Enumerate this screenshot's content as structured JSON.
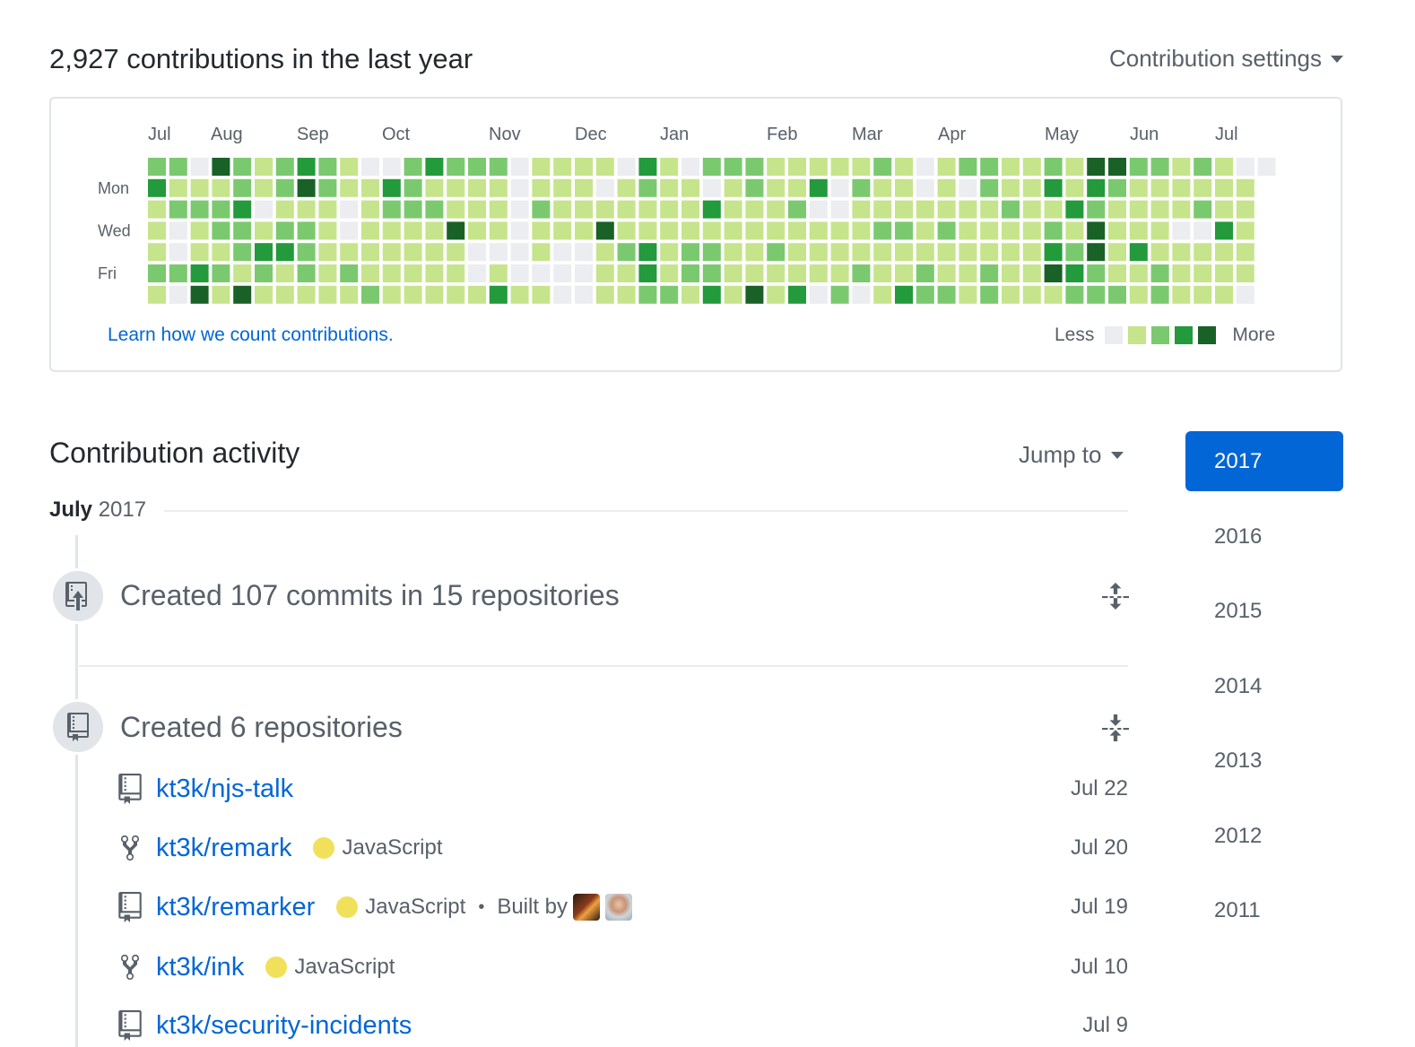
{
  "header": {
    "contributions_title": "2,927 contributions in the last year",
    "settings_label": "Contribution settings",
    "settings_caret_icon": "triangle-down"
  },
  "calendar": {
    "months": [
      "Jul",
      "Aug",
      "Sep",
      "Oct",
      "Nov",
      "Dec",
      "Jan",
      "Feb",
      "Mar",
      "Apr",
      "May",
      "Jun",
      "Jul"
    ],
    "day_labels": [
      "Mon",
      "Wed",
      "Fri"
    ],
    "learn_link": "Learn how we count contributions.",
    "legend_less": "Less",
    "legend_more": "More",
    "colors": [
      "#ebedf0",
      "#c6e48b",
      "#7bc96f",
      "#239a3b",
      "#196127"
    ],
    "weeks": [
      [
        2,
        3,
        1,
        1,
        1,
        2,
        1
      ],
      [
        2,
        1,
        2,
        0,
        0,
        2,
        0
      ],
      [
        0,
        1,
        2,
        1,
        1,
        3,
        4
      ],
      [
        4,
        1,
        2,
        2,
        1,
        2,
        1
      ],
      [
        2,
        2,
        3,
        2,
        2,
        1,
        4
      ],
      [
        1,
        1,
        0,
        1,
        3,
        2,
        1
      ],
      [
        2,
        2,
        1,
        2,
        3,
        1,
        1
      ],
      [
        3,
        4,
        1,
        2,
        2,
        2,
        1
      ],
      [
        2,
        2,
        1,
        1,
        1,
        1,
        1
      ],
      [
        1,
        1,
        0,
        0,
        1,
        2,
        1
      ],
      [
        0,
        1,
        1,
        1,
        1,
        1,
        2
      ],
      [
        0,
        3,
        2,
        1,
        1,
        1,
        1
      ],
      [
        2,
        2,
        2,
        1,
        1,
        1,
        1
      ],
      [
        3,
        1,
        2,
        1,
        1,
        1,
        1
      ],
      [
        2,
        1,
        1,
        4,
        1,
        1,
        1
      ],
      [
        2,
        1,
        1,
        1,
        0,
        0,
        1
      ],
      [
        2,
        1,
        1,
        1,
        0,
        1,
        3
      ],
      [
        0,
        0,
        0,
        0,
        0,
        0,
        1
      ],
      [
        1,
        1,
        2,
        1,
        1,
        0,
        1
      ],
      [
        1,
        1,
        1,
        1,
        0,
        0,
        0
      ],
      [
        1,
        1,
        1,
        1,
        0,
        0,
        0
      ],
      [
        1,
        0,
        1,
        4,
        1,
        1,
        1
      ],
      [
        0,
        1,
        1,
        1,
        2,
        1,
        1
      ],
      [
        3,
        2,
        1,
        1,
        3,
        3,
        2
      ],
      [
        1,
        1,
        1,
        1,
        1,
        1,
        2
      ],
      [
        0,
        1,
        1,
        1,
        2,
        2,
        1
      ],
      [
        2,
        0,
        3,
        1,
        2,
        2,
        3
      ],
      [
        2,
        1,
        1,
        1,
        1,
        1,
        1
      ],
      [
        2,
        2,
        1,
        1,
        1,
        1,
        4
      ],
      [
        1,
        1,
        1,
        1,
        2,
        1,
        1
      ],
      [
        1,
        1,
        2,
        1,
        1,
        1,
        3
      ],
      [
        1,
        3,
        0,
        1,
        1,
        1,
        0
      ],
      [
        1,
        0,
        0,
        1,
        1,
        1,
        2
      ],
      [
        1,
        2,
        1,
        1,
        1,
        2,
        0
      ],
      [
        2,
        1,
        1,
        2,
        1,
        1,
        1
      ],
      [
        1,
        1,
        1,
        2,
        1,
        1,
        3
      ],
      [
        0,
        0,
        1,
        1,
        1,
        2,
        2
      ],
      [
        1,
        1,
        1,
        2,
        1,
        1,
        2
      ],
      [
        2,
        0,
        1,
        1,
        1,
        1,
        1
      ],
      [
        2,
        2,
        1,
        1,
        1,
        2,
        2
      ],
      [
        1,
        1,
        2,
        1,
        1,
        1,
        1
      ],
      [
        1,
        1,
        1,
        1,
        1,
        1,
        1
      ],
      [
        2,
        3,
        1,
        2,
        3,
        4,
        1
      ],
      [
        1,
        1,
        3,
        1,
        2,
        3,
        2
      ],
      [
        4,
        3,
        2,
        4,
        4,
        2,
        2
      ],
      [
        4,
        2,
        1,
        1,
        1,
        1,
        2
      ],
      [
        2,
        1,
        1,
        1,
        3,
        1,
        1
      ],
      [
        2,
        1,
        1,
        1,
        1,
        2,
        2
      ],
      [
        1,
        1,
        1,
        0,
        1,
        1,
        1
      ],
      [
        2,
        1,
        2,
        0,
        1,
        1,
        1
      ],
      [
        1,
        1,
        1,
        3,
        1,
        1,
        1
      ],
      [
        0,
        1,
        1,
        1,
        1,
        1,
        0
      ]
    ]
  },
  "activity": {
    "title": "Contribution activity",
    "jump_to": "Jump to",
    "month_label": "July",
    "month_year": "2017",
    "commits_event": "Created 107 commits in 15 repositories",
    "repos_event": "Created 6 repositories",
    "repos": [
      {
        "name": "kt3k/njs-talk",
        "icon": "repo-icon",
        "language": "",
        "built_by": "",
        "date": "Jul 22"
      },
      {
        "name": "kt3k/remark",
        "icon": "fork-icon",
        "language": "JavaScript",
        "built_by": "",
        "date": "Jul 20"
      },
      {
        "name": "kt3k/remarker",
        "icon": "repo-icon",
        "language": "JavaScript",
        "built_by": "Built by",
        "date": "Jul 19"
      },
      {
        "name": "kt3k/ink",
        "icon": "fork-icon",
        "language": "JavaScript",
        "built_by": "",
        "date": "Jul 10"
      },
      {
        "name": "kt3k/security-incidents",
        "icon": "repo-icon",
        "language": "",
        "built_by": "",
        "date": "Jul 9"
      }
    ],
    "language_color": "#f1e05a"
  },
  "years": {
    "active": "2017",
    "list": [
      "2017",
      "2016",
      "2015",
      "2014",
      "2013",
      "2012",
      "2011"
    ]
  },
  "theme": {
    "link_color": "#0366d6",
    "active_year_bg": "#0366d6"
  }
}
